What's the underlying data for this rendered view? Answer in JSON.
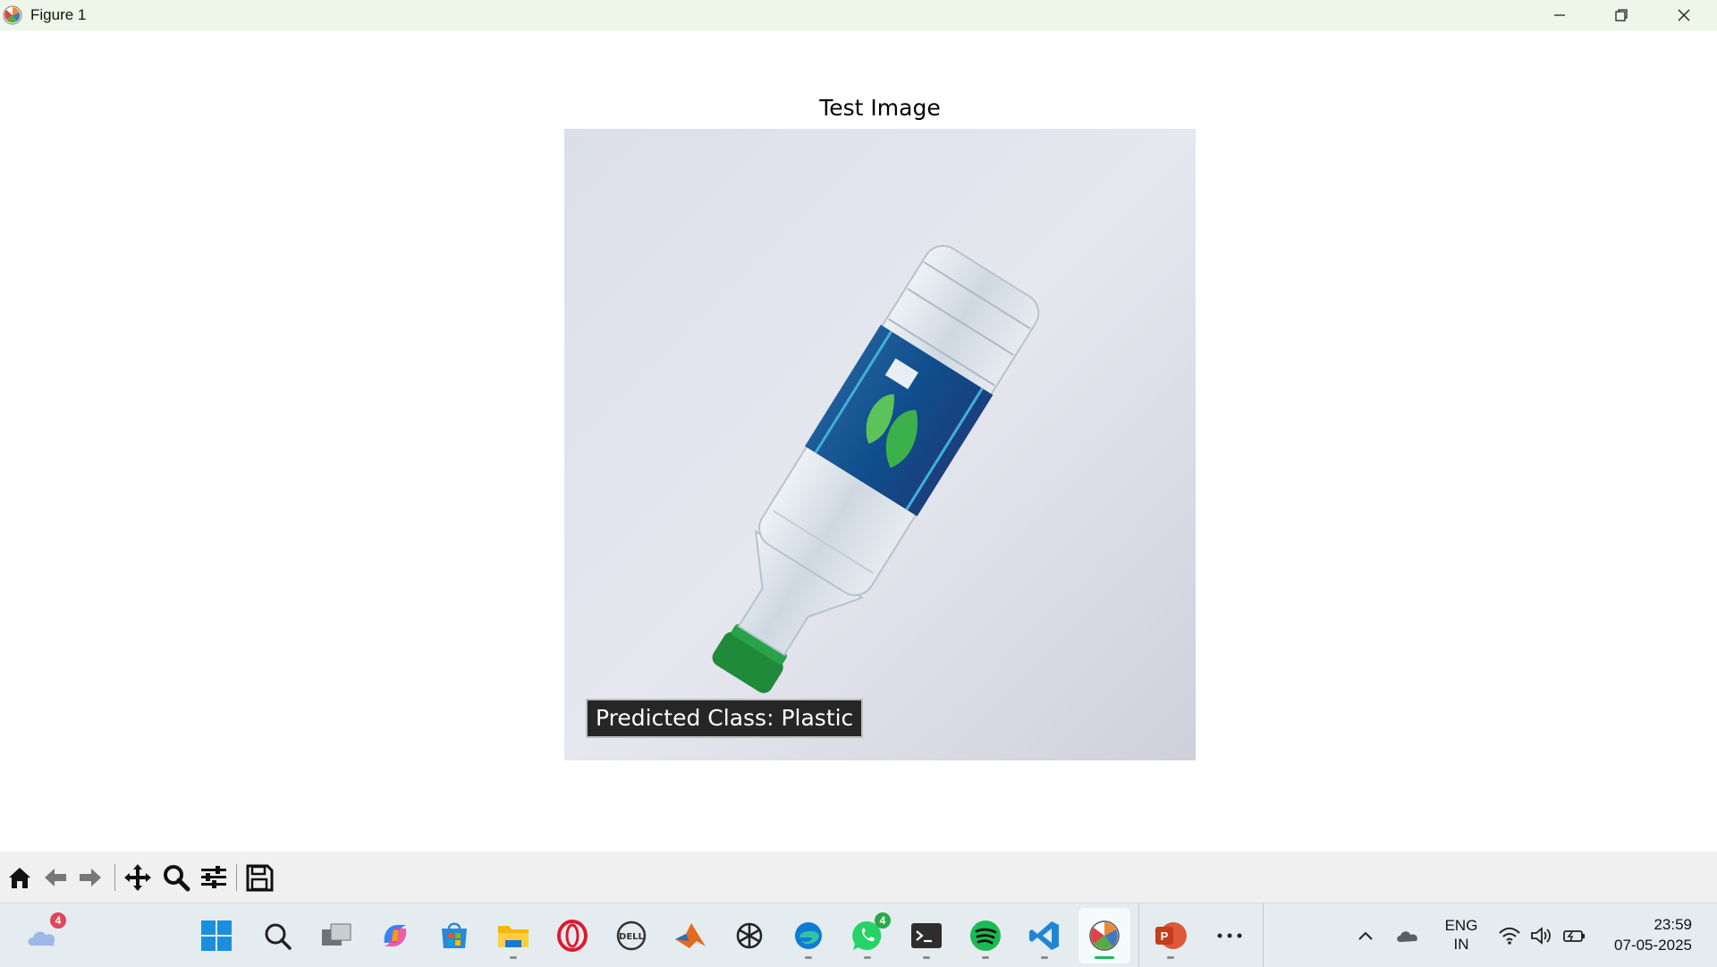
{
  "window": {
    "title": "Figure 1"
  },
  "plot": {
    "title": "Test Image",
    "prediction_label": "Predicted Class: Plastic"
  },
  "toolbar": {
    "buttons": [
      "home-icon",
      "back-arrow-icon",
      "forward-arrow-icon",
      "pan-move-icon",
      "zoom-magnifier-icon",
      "configure-subplots-icon",
      "save-floppy-icon"
    ]
  },
  "taskbar": {
    "weather_badge": "4",
    "whatsapp_badge": "4",
    "apps": [
      "windows-start-icon",
      "search-icon",
      "task-view-icon",
      "copilot-icon",
      "microsoft-store-icon",
      "file-explorer-icon",
      "opera-icon",
      "dell-icon",
      "matlab-icon",
      "chatgpt-icon",
      "edge-icon",
      "whatsapp-icon",
      "terminal-icon",
      "spotify-icon",
      "vscode-icon",
      "matplotlib-figure-icon",
      "powerpoint-icon",
      "more-icon"
    ]
  },
  "tray": {
    "language_line1": "ENG",
    "language_line2": "IN",
    "time": "23:59",
    "date": "07-05-2025"
  },
  "colors": {
    "titlebar_bg": "#eef6e9",
    "toolbar_bg": "#f0f0f0",
    "taskbar_bg": "#e4ecef",
    "label_bg": "#262626"
  }
}
